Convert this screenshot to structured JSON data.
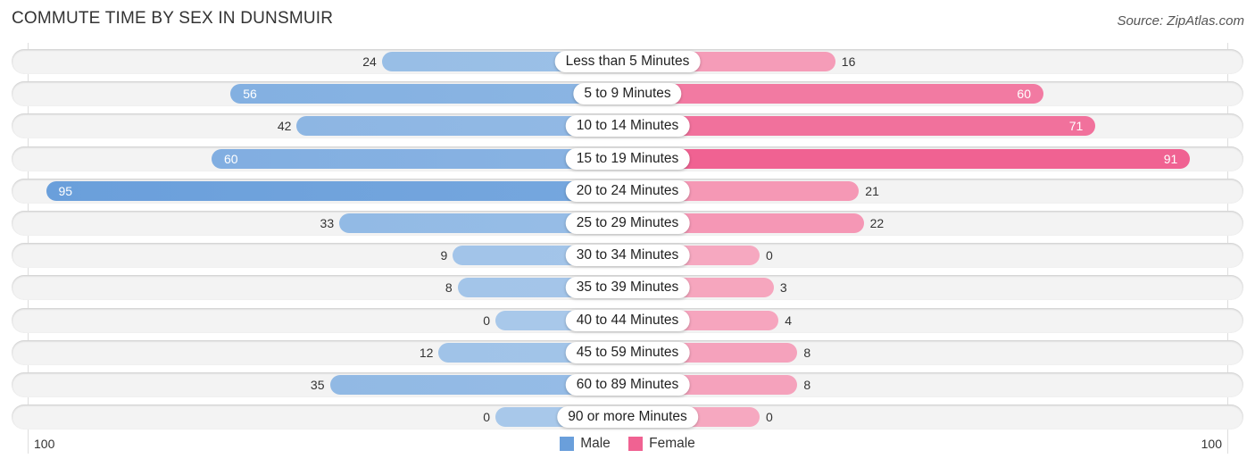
{
  "title": "COMMUTE TIME BY SEX IN DUNSMUIR",
  "source": "Source: ZipAtlas.com",
  "colors": {
    "male": "#6a9fdb",
    "male_light": "#a8c8ea",
    "female": "#f06292",
    "female_light": "#f6a8c0"
  },
  "chart_data": {
    "type": "bar",
    "orientation": "horizontal-diverging",
    "title": "COMMUTE TIME BY SEX IN DUNSMUIR",
    "categories": [
      "Less than 5 Minutes",
      "5 to 9 Minutes",
      "10 to 14 Minutes",
      "15 to 19 Minutes",
      "20 to 24 Minutes",
      "25 to 29 Minutes",
      "30 to 34 Minutes",
      "35 to 39 Minutes",
      "40 to 44 Minutes",
      "45 to 59 Minutes",
      "60 to 89 Minutes",
      "90 or more Minutes"
    ],
    "series": [
      {
        "name": "Male",
        "values": [
          24,
          56,
          42,
          60,
          95,
          33,
          9,
          8,
          0,
          12,
          35,
          0
        ]
      },
      {
        "name": "Female",
        "values": [
          16,
          60,
          71,
          91,
          21,
          22,
          0,
          3,
          4,
          8,
          8,
          0
        ]
      }
    ],
    "axis": {
      "left_label": "100",
      "right_label": "100",
      "range": [
        0,
        100
      ]
    },
    "legend": {
      "position": "bottom-center",
      "entries": [
        "Male",
        "Female"
      ]
    }
  }
}
